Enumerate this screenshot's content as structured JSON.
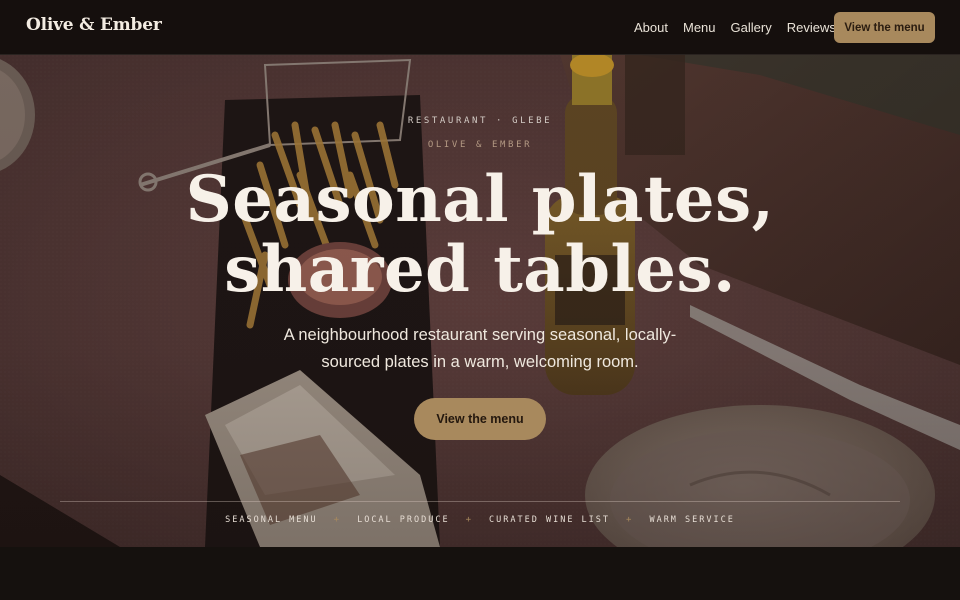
{
  "nav": {
    "brand": "Olive & Ember",
    "links": [
      "About",
      "Menu",
      "Gallery",
      "Reviews"
    ],
    "cta": "View the menu"
  },
  "hero": {
    "eyebrow": "RESTAURANT · GLEBE",
    "eyebrow_secondary": "OLIVE & EMBER",
    "headline_line1": "Seasonal plates,",
    "headline_line2": "shared tables.",
    "subtext_line1": "A neighbourhood restaurant serving seasonal, locally-",
    "subtext_line2": "sourced plates in a warm, welcoming room.",
    "cta": "View the menu",
    "features": [
      "SEASONAL MENU",
      "LOCAL PRODUCE",
      "CURATED WINE LIST",
      "WARM SERVICE"
    ],
    "feature_separator": "+"
  },
  "colors": {
    "accent": "#a8895d",
    "nav_background": "#150f0d",
    "hero_text": "#f7f1e9"
  }
}
